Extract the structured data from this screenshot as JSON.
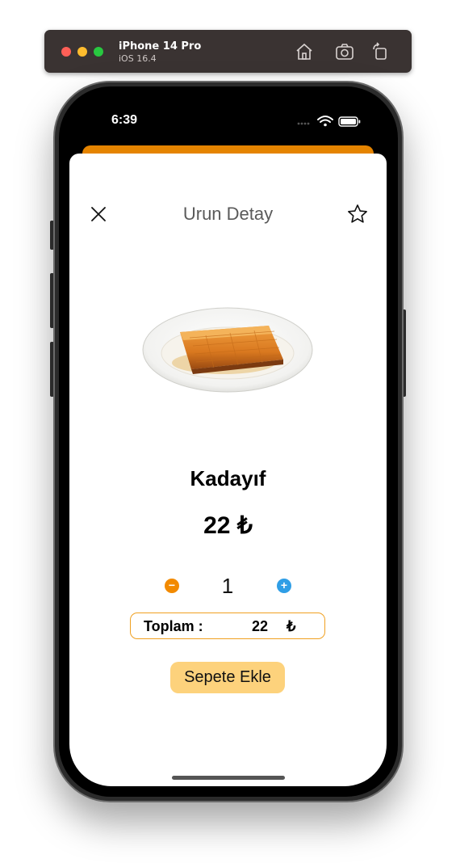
{
  "simulator": {
    "device_name": "iPhone 14 Pro",
    "os_version": "iOS 16.4",
    "buttons": [
      "home-icon",
      "screenshot-icon",
      "rotate-icon"
    ]
  },
  "status_bar": {
    "time": "6:39"
  },
  "header": {
    "title": "Urun Detay",
    "close_icon": "close-icon",
    "favorite_icon": "star-icon"
  },
  "product": {
    "name": "Kadayıf",
    "price": "22",
    "currency": "₺"
  },
  "quantity": {
    "value": "1",
    "minus_symbol": "−",
    "plus_symbol": "+"
  },
  "total": {
    "label": "Toplam :",
    "value": "22",
    "currency": "₺"
  },
  "actions": {
    "add_to_cart_label": "Sepete Ekle"
  },
  "colors": {
    "accent_orange": "#e58400",
    "minus_button": "#f28a00",
    "plus_button": "#2f9ee6",
    "add_button": "#fdd27c",
    "total_border": "#f0a020"
  }
}
